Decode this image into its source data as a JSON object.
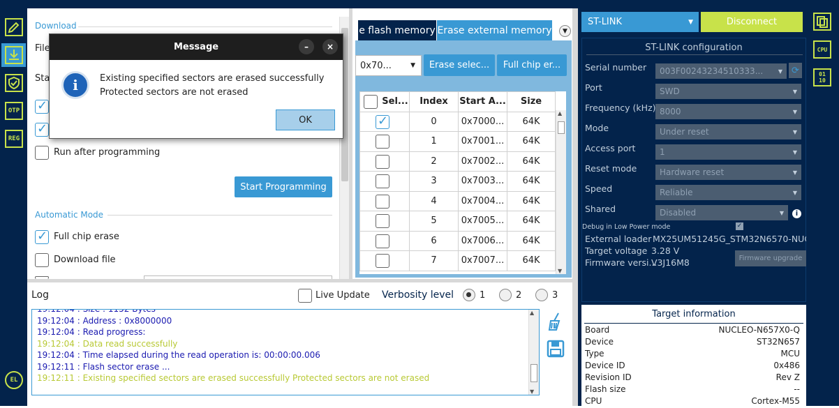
{
  "colors": {
    "navy": "#03234b",
    "accent": "#3999d4",
    "lime": "#c8e24a",
    "log_blue": "#1a1ab0",
    "log_yellow": "#b8c934"
  },
  "left_icons": [
    "edit-icon",
    "download-icon",
    "shield-icon",
    "otp-icon",
    "reg-icon",
    "el-icon"
  ],
  "left_icon_labels": {
    "otp": "OTP",
    "reg": "REG",
    "el": "EL"
  },
  "download": {
    "section_title": "Download",
    "file_label": "File",
    "start_label": "Sta",
    "run_after_label": "Run after programming",
    "start_programming": "Start Programming"
  },
  "automatic": {
    "section_title": "Automatic Mode",
    "full_chip_erase": "Full chip erase",
    "download_file": "Download file"
  },
  "dialog": {
    "title": "Message",
    "line1": "Existing specified sectors are erased successfully",
    "line2": "Protected sectors are not erased",
    "ok": "OK",
    "minimize": "–",
    "close": "×"
  },
  "erase": {
    "tab_flash": "e flash memory",
    "tab_external": "Erase external memory",
    "address": "0x70...",
    "erase_selected": "Erase selec...",
    "full_chip": "Full chip er...",
    "columns": [
      "Sel...",
      "Index",
      "Start A...",
      "Size"
    ],
    "rows": [
      {
        "index": "0",
        "start": "0x7000...",
        "size": "64K",
        "checked": true
      },
      {
        "index": "1",
        "start": "0x7001...",
        "size": "64K",
        "checked": false
      },
      {
        "index": "2",
        "start": "0x7002...",
        "size": "64K",
        "checked": false
      },
      {
        "index": "3",
        "start": "0x7003...",
        "size": "64K",
        "checked": false
      },
      {
        "index": "4",
        "start": "0x7004...",
        "size": "64K",
        "checked": false
      },
      {
        "index": "5",
        "start": "0x7005...",
        "size": "64K",
        "checked": false
      },
      {
        "index": "6",
        "start": "0x7006...",
        "size": "64K",
        "checked": false
      },
      {
        "index": "7",
        "start": "0x7007...",
        "size": "64K",
        "checked": false
      }
    ]
  },
  "log": {
    "title": "Log",
    "live_update": "Live Update",
    "verbosity": "Verbosity level",
    "levels": [
      "1",
      "2",
      "3"
    ],
    "lines": [
      {
        "text": "19:12:04 :   Size        : 1152 Bytes",
        "color": "blue"
      },
      {
        "text": "19:12:04 :   Address       : 0x8000000",
        "color": "blue"
      },
      {
        "text": "19:12:04 : Read progress:",
        "color": "blue"
      },
      {
        "text": "19:12:04 : Data read successfully",
        "color": "yellow"
      },
      {
        "text": "19:12:04 : Time elapsed during the read operation is: 00:00:00.006",
        "color": "blue"
      },
      {
        "text": "19:12:11 : Flash sector erase ...",
        "color": "blue"
      },
      {
        "text": "19:12:11 : Existing specified sectors are erased successfully Protected sectors are not erased",
        "color": "yellow"
      }
    ]
  },
  "connection": {
    "probe": "ST-LINK",
    "disconnect": "Disconnect",
    "config_title": "ST-LINK configuration",
    "fields": [
      {
        "label": "Serial number",
        "value": "003F00243234510333..."
      },
      {
        "label": "Port",
        "value": "SWD"
      },
      {
        "label": "Frequency (kHz)",
        "value": "8000"
      },
      {
        "label": "Mode",
        "value": "Under reset"
      },
      {
        "label": "Access port",
        "value": "1"
      },
      {
        "label": "Reset mode",
        "value": "Hardware reset"
      },
      {
        "label": "Speed",
        "value": "Reliable"
      },
      {
        "label": "Shared",
        "value": "Disabled"
      }
    ],
    "debug_low_power": "Debug in Low Power mode",
    "external_loader_label": "External loader",
    "external_loader": "MX25UM51245G_STM32N6570-NUCL...",
    "target_voltage_label": "Target voltage",
    "target_voltage": "3.28 V",
    "firmware_label": "Firmware versi...",
    "firmware": "V3J16M8",
    "firmware_upgrade": "Firmware upgrade"
  },
  "target": {
    "title": "Target information",
    "rows": [
      {
        "label": "Board",
        "value": "NUCLEO-N657X0-Q"
      },
      {
        "label": "Device",
        "value": "ST32N657"
      },
      {
        "label": "Type",
        "value": "MCU"
      },
      {
        "label": "Device ID",
        "value": "0x486"
      },
      {
        "label": "Revision ID",
        "value": "Rev Z"
      },
      {
        "label": "Flash size",
        "value": "--"
      },
      {
        "label": "CPU",
        "value": "Cortex-M55"
      }
    ]
  },
  "right_icons": {
    "cpu": "CPU",
    "binary": "01 10"
  }
}
